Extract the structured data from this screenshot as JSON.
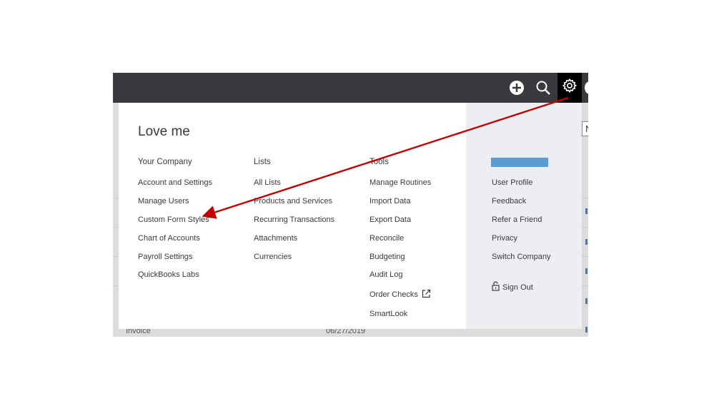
{
  "topbar": {
    "icons": [
      "add-icon",
      "search-icon",
      "gear-icon"
    ]
  },
  "background": {
    "rows": [
      {
        "type": "Invoice",
        "date": "06/27/2019"
      }
    ],
    "peek_letter": "N"
  },
  "menu": {
    "greeting": "Love me",
    "columns": [
      {
        "title": "Your Company",
        "items": [
          "Account and Settings",
          "Manage Users",
          "Custom Form Styles",
          "Chart of Accounts",
          "Payroll Settings",
          "QuickBooks Labs"
        ]
      },
      {
        "title": "Lists",
        "items": [
          "All Lists",
          "Products and Services",
          "Recurring Transactions",
          "Attachments",
          "Currencies"
        ]
      },
      {
        "title": "Tools",
        "items": [
          "Manage Routines",
          "Import Data",
          "Export Data",
          "Reconcile",
          "Budgeting",
          "Audit Log",
          "Order Checks",
          "SmartLook"
        ]
      }
    ],
    "profile": {
      "items": [
        "User Profile",
        "Feedback",
        "Refer a Friend",
        "Privacy",
        "Switch Company"
      ],
      "sign_out": "Sign Out"
    }
  },
  "annotation": {
    "arrow_color": "#c00000"
  },
  "colors": {
    "topbar": "#393a3d",
    "menu_side": "#eceef1",
    "accent": "#5b9bd5"
  }
}
